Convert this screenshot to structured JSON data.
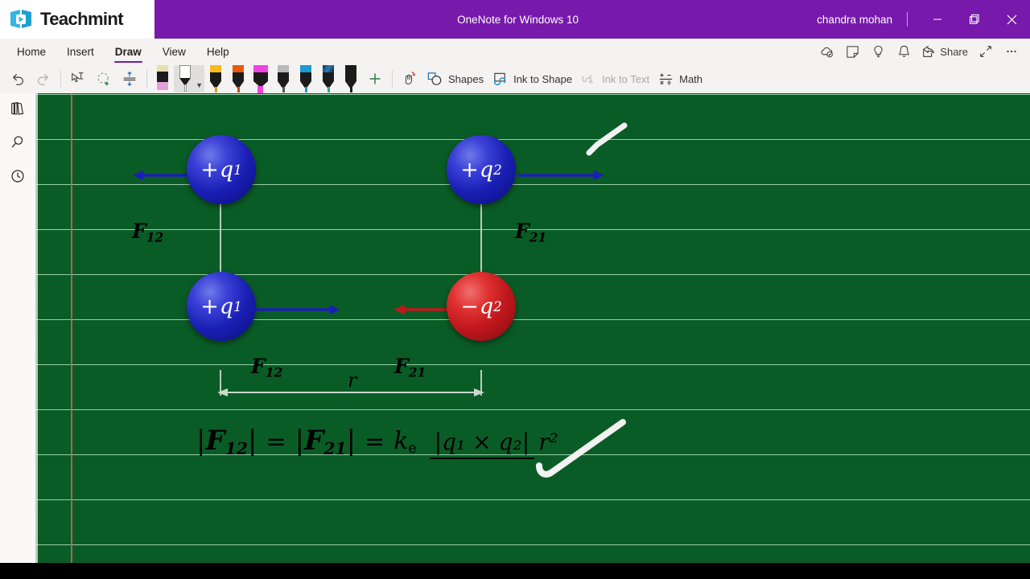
{
  "brand": {
    "name": "Teachmint",
    "logo_icon": "book-play-logo"
  },
  "titlebar": {
    "app_title": "OneNote for Windows 10",
    "account_name": "chandra mohan",
    "bg_color": "#7719AA",
    "minimize_icon": "minimize-icon",
    "maximize_icon": "maximize-icon",
    "close_icon": "close-icon"
  },
  "ribbon": {
    "tabs": [
      {
        "label": "Home",
        "active": false
      },
      {
        "label": "Insert",
        "active": false
      },
      {
        "label": "Draw",
        "active": true
      },
      {
        "label": "View",
        "active": false
      },
      {
        "label": "Help",
        "active": false
      }
    ],
    "active_tab_underline_color": "#7719AA",
    "right_items": [
      {
        "label": "",
        "icon": "sync-cloud-icon"
      },
      {
        "label": "",
        "icon": "sticky-note-icon"
      },
      {
        "label": "",
        "icon": "lightbulb-icon"
      },
      {
        "label": "",
        "icon": "bell-icon"
      },
      {
        "label": "Share",
        "icon": "share-icon"
      },
      {
        "label": "",
        "icon": "expand-arrows-icon"
      },
      {
        "label": "",
        "icon": "more-ellipsis-icon"
      }
    ]
  },
  "toolbar": {
    "undo_label": "Undo",
    "redo_label": "Redo",
    "lasso_label": "Lasso Select",
    "shape_add_label": "Insert Space",
    "ruler_label": "Ruler",
    "pens": [
      {
        "name": "eraser",
        "type": "eraser",
        "cap": "#e8dfb0",
        "accent": "#e59fd8",
        "selected": false
      },
      {
        "name": "pen-white",
        "type": "pen-white",
        "cap": "#ffffff",
        "accent": "#ffffff",
        "selected": true
      },
      {
        "name": "pen-yellow",
        "type": "pen",
        "cap": "#f5bb1d",
        "accent": "#d8a017",
        "selected": false
      },
      {
        "name": "pen-orange",
        "type": "pen",
        "cap": "#e8590c",
        "accent": "#c74a08",
        "selected": false
      },
      {
        "name": "highlighter-magenta",
        "type": "highlighter",
        "cap": "#ee44e0",
        "accent": "#ee44e0",
        "selected": false
      },
      {
        "name": "pencil-gray",
        "type": "pencil",
        "cap": "#b9b9b9",
        "accent": "#6b6b6b",
        "selected": false
      },
      {
        "name": "pen-blue",
        "type": "pen",
        "cap": "#1a9ad0",
        "accent": "#1a9ad0",
        "selected": false
      },
      {
        "name": "pen-galaxy",
        "type": "pen",
        "cap": "#1b3a6b",
        "accent": "#2aa6a0",
        "selected": false
      },
      {
        "name": "pen-black",
        "type": "pen",
        "cap": "#1b1b1b",
        "accent": "#1b1b1b",
        "selected": false
      }
    ],
    "add_pen_label": "+",
    "touch_draw_icon": "draw-with-touch-icon",
    "shapes_label": "Shapes",
    "ink_to_shape_label": "Ink to Shape",
    "ink_to_text_label": "Ink to Text",
    "ink_to_text_disabled": true,
    "math_label": "Math"
  },
  "rail": {
    "items": [
      {
        "name": "notebooks",
        "icon": "notebooks-icon"
      },
      {
        "name": "search",
        "icon": "search-icon"
      },
      {
        "name": "recent",
        "icon": "clock-recent-icon"
      }
    ]
  },
  "canvas": {
    "page_bg_color": "#0a5c26",
    "rule_color": "#b9e8c6",
    "margin_line_color": "#c46a5a",
    "diagram": {
      "title": "Coulomb's law force diagram",
      "charges": [
        {
          "id": "top-left",
          "sign": "+",
          "symbol": "q",
          "sub": "1",
          "polarity": "positive",
          "color": "#1a1fb4"
        },
        {
          "id": "top-right",
          "sign": "+",
          "symbol": "q",
          "sub": "2",
          "polarity": "positive",
          "color": "#1a1fb4"
        },
        {
          "id": "bottom-left",
          "sign": "+",
          "symbol": "q",
          "sub": "1",
          "polarity": "positive",
          "color": "#1a1fb4"
        },
        {
          "id": "bottom-right",
          "sign": "−",
          "symbol": "q",
          "sub": "2",
          "polarity": "negative",
          "color": "#c0171d"
        }
      ],
      "force_labels": [
        {
          "id": "top-left-F",
          "symbol": "F",
          "sub": "12",
          "arrow_direction": "left",
          "arrow_color": "#1a1fb4"
        },
        {
          "id": "top-right-F",
          "symbol": "F",
          "sub": "21",
          "arrow_direction": "right",
          "arrow_color": "#1a1fb4"
        },
        {
          "id": "bottom-left-F",
          "symbol": "F",
          "sub": "12",
          "arrow_direction": "right",
          "arrow_color": "#1a1fb4"
        },
        {
          "id": "bottom-right-F",
          "symbol": "F",
          "sub": "21",
          "arrow_direction": "left",
          "arrow_color": "#c0171d"
        }
      ],
      "distance_label": "r",
      "formula": {
        "lhs1": "|F",
        "lhs1_sub": "12",
        "lhs1_end": "|",
        "eq": "=",
        "lhs2": "|F",
        "lhs2_sub": "21",
        "lhs2_end": "|",
        "eq2": "=",
        "constant": "k",
        "constant_sub": "e",
        "numerator": "|q₁ × q₂|",
        "denominator": "r²",
        "plain": "|F12| = |F21| = ke |q1 × q2| / r^2"
      },
      "ink_strokes": [
        {
          "id": "checkmark-top",
          "shape": "check",
          "color": "#f2f2f2"
        },
        {
          "id": "checkmark-bottom",
          "shape": "check",
          "color": "#f2f2f2"
        }
      ]
    }
  }
}
